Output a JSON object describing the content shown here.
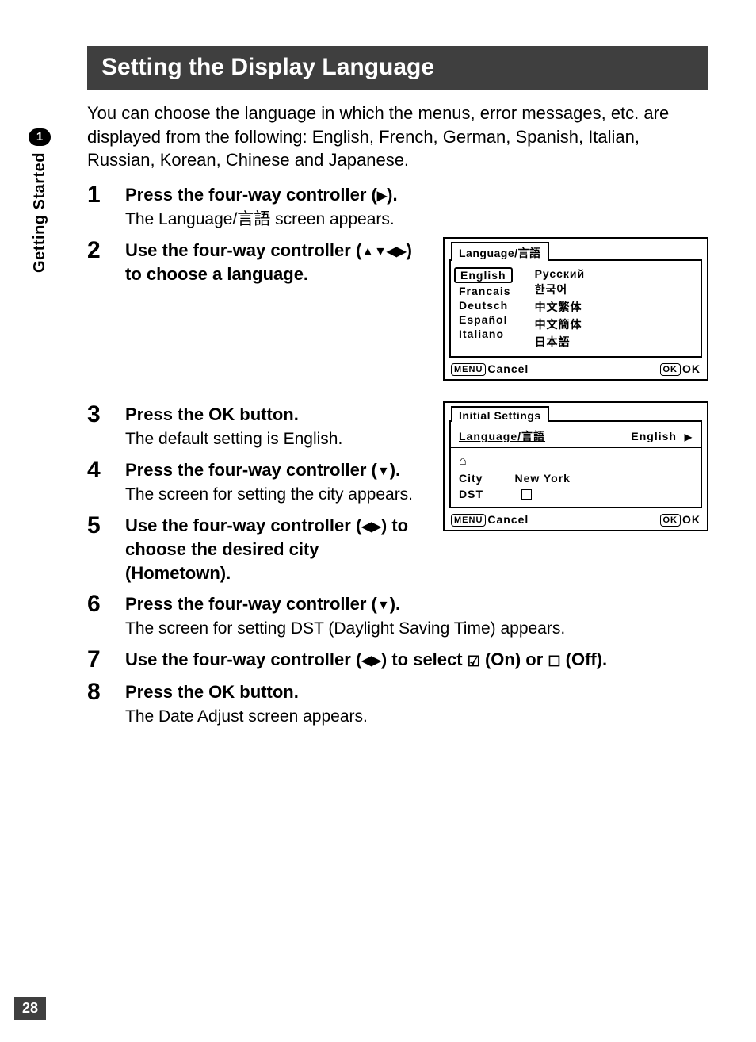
{
  "page_number": "28",
  "sidebar": {
    "chapter_num": "1",
    "chapter_title": "Getting Started"
  },
  "title": "Setting the Display Language",
  "intro": "You can choose the language in which the menus, error messages, etc. are displayed from the following: English, French, German, Spanish, Italian, Russian, Korean, Chinese and Japanese.",
  "steps": [
    {
      "num": "1",
      "head_pre": "Press the four-way controller (",
      "head_arrow": "▶",
      "head_post": ").",
      "desc": "The Language/言語  screen appears."
    },
    {
      "num": "2",
      "head_pre": "Use the four-way controller (",
      "head_arrow": "▲▼◀▶",
      "head_post": ") to choose a language."
    },
    {
      "num": "3",
      "head_pre": "Press the ",
      "head_ok": "OK",
      "head_post": " button.",
      "desc": "The default setting is English."
    },
    {
      "num": "4",
      "head_pre": "Press the four-way controller (",
      "head_arrow": "▼",
      "head_post": ").",
      "desc": "The screen for setting the city appears."
    },
    {
      "num": "5",
      "head_pre": "Use the four-way controller (",
      "head_arrow": "◀▶",
      "head_post": ") to choose the desired city (Hometown)."
    },
    {
      "num": "6",
      "head_pre": "Press the four-way controller (",
      "head_arrow": "▼",
      "head_post": ").",
      "desc": "The screen for setting DST (Daylight Saving Time) appears."
    },
    {
      "num": "7",
      "head_pre": "Use the four-way controller (",
      "head_arrow": "◀▶",
      "head_post_a": ") to select ",
      "on_label": " (On) or ",
      "off_label": " (Off)."
    },
    {
      "num": "8",
      "head_pre": "Press the ",
      "head_ok": "OK",
      "head_post": " button.",
      "desc": "The Date Adjust screen appears."
    }
  ],
  "fig1": {
    "title": "Language/言語",
    "col1": [
      "English",
      "Francais",
      "Deutsch",
      "Español",
      "Italiano"
    ],
    "col2": [
      "Русский",
      "한국어",
      "中文繁体",
      "中文簡体",
      "日本語"
    ],
    "footer_left_btn": "MENU",
    "footer_left": "Cancel",
    "footer_right_btn": "OK",
    "footer_right": "OK"
  },
  "fig2": {
    "title": "Initial Settings",
    "lang_label": "Language/言語",
    "lang_value": "English",
    "city_label": "City",
    "city_value": "New York",
    "dst_label": "DST",
    "footer_left_btn": "MENU",
    "footer_left": "Cancel",
    "footer_right_btn": "OK",
    "footer_right": "OK"
  }
}
